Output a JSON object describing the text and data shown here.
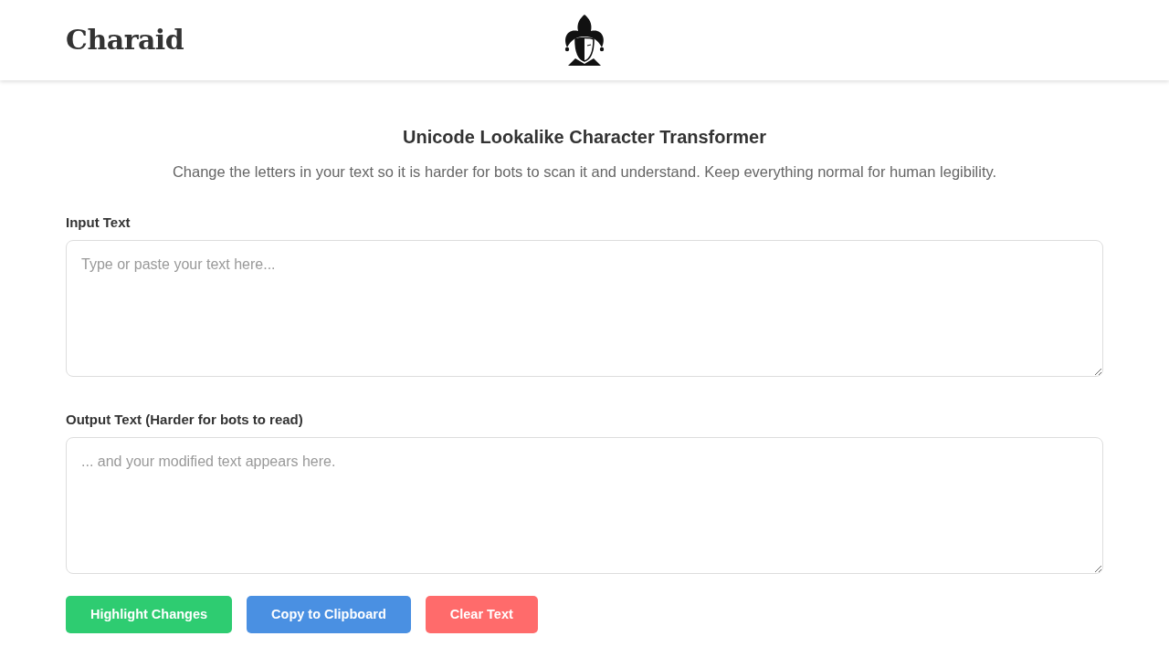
{
  "header": {
    "logo": "Charaid"
  },
  "title": "Unicode Lookalike Character Transformer",
  "description": "Change the letters in your text so it is harder for bots to scan it and understand. Keep everything normal for human legibility.",
  "fields": [
    {
      "label": "Input Text",
      "placeholder": "Type or paste your text here..."
    },
    {
      "label": "Output Text (Harder for bots to read)",
      "placeholder": "... and your modified text appears here."
    }
  ],
  "buttons": [
    {
      "label": "Highlight Changes",
      "color": "#2ecc71"
    },
    {
      "label": "Copy to Clipboard",
      "color": "#4a90e2"
    },
    {
      "label": "Clear Text",
      "color": "#ff6b6b"
    }
  ]
}
